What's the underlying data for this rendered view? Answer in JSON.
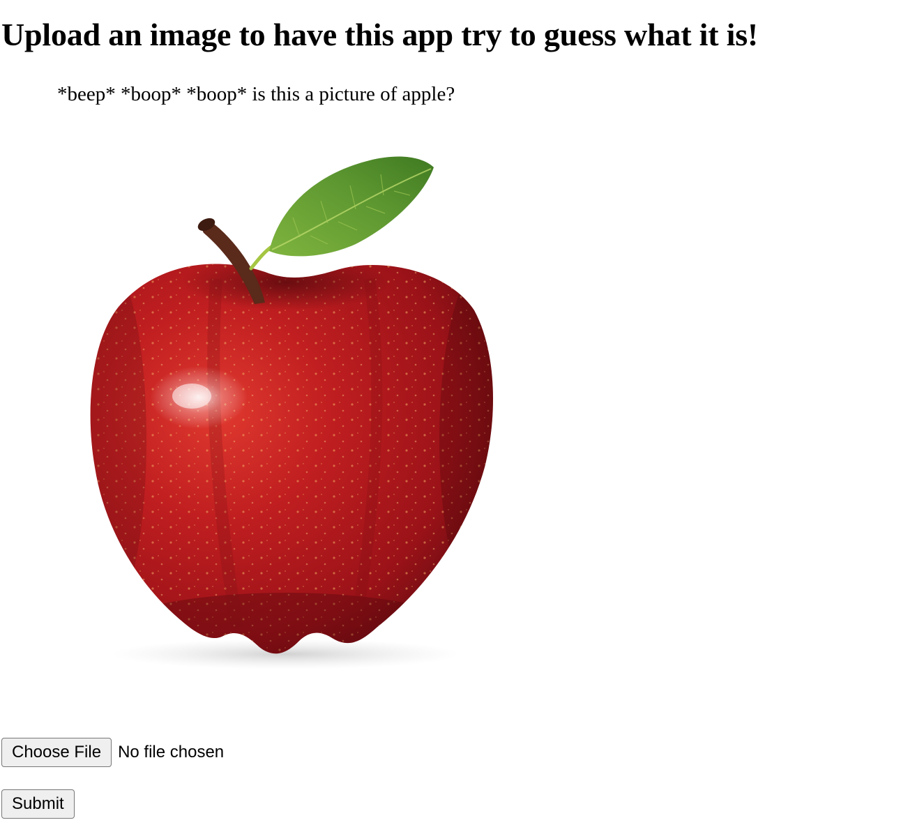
{
  "page": {
    "heading": "Upload an image to have this app try to guess what it is!",
    "guess_text": "*beep* *boop* *boop* is this a picture of apple?"
  },
  "image": {
    "subject": "red apple with stem and green leaf",
    "colors": {
      "apple_red": "#b3161c",
      "apple_dark": "#6e0d12",
      "leaf_green": "#5f9a2e",
      "stem_brown": "#5a2a1a"
    }
  },
  "upload_form": {
    "choose_file_label": "Choose File",
    "file_status": "No file chosen",
    "submit_label": "Submit"
  }
}
